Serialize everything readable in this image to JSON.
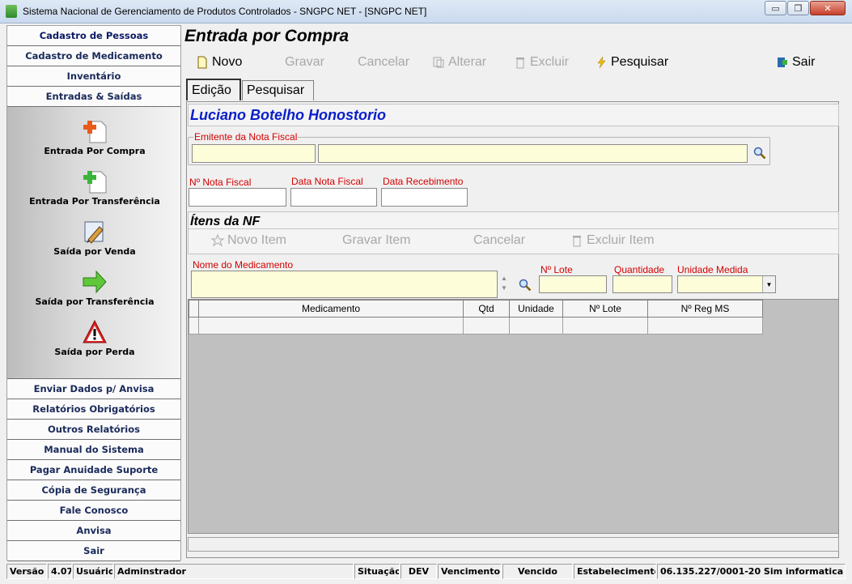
{
  "window": {
    "title": "Sistema Nacional de Gerenciamento de Produtos Controlados - SNGPC NET - [SNGPC NET]",
    "controls": {
      "minimize": "▭",
      "maximize": "❐",
      "close": "✕"
    }
  },
  "sidebar": {
    "top_items": [
      {
        "label": "Cadastro de Pessoas"
      },
      {
        "label": "Cadastro de Medicamento"
      },
      {
        "label": "Inventário"
      },
      {
        "label": "Entradas & Saídas"
      }
    ],
    "sub_items": [
      {
        "label": "Entrada Por Compra",
        "icon": "add-document-icon"
      },
      {
        "label": "Entrada Por Transferência",
        "icon": "add-green-document-icon"
      },
      {
        "label": "Saída por Venda",
        "icon": "pen-edit-icon"
      },
      {
        "label": "Saída por Transferência",
        "icon": "green-arrow-icon"
      },
      {
        "label": "Saída por Perda",
        "icon": "warning-icon"
      }
    ],
    "bottom_items": [
      {
        "label": "Enviar Dados p/ Anvisa"
      },
      {
        "label": "Relatórios Obrigatórios"
      },
      {
        "label": "Outros Relatórios"
      },
      {
        "label": "Manual do Sistema"
      },
      {
        "label": "Pagar Anuidade Suporte"
      },
      {
        "label": "Cópia de Segurança"
      },
      {
        "label": "Fale Conosco"
      },
      {
        "label": "Anvisa"
      },
      {
        "label": "Sair"
      }
    ]
  },
  "form": {
    "title": "Entrada por Compra",
    "toolbar": {
      "novo": "Novo",
      "gravar": "Gravar",
      "cancelar": "Cancelar",
      "alterar": "Alterar",
      "excluir": "Excluir",
      "pesquisar": "Pesquisar",
      "sair": "Sair"
    },
    "tabs": [
      "Edição",
      "Pesquisar"
    ],
    "person_name": "Luciano Botelho Honostorio",
    "emitente_legend": "Emitente da Nota Fiscal",
    "labels": {
      "nota_fiscal": "Nº Nota Fiscal",
      "data_nota": "Data Nota Fiscal",
      "data_recebimento": "Data Recebimento"
    },
    "items_section": "Ítens da NF",
    "items_toolbar": {
      "novo_item": "Novo Item",
      "gravar_item": "Gravar Item",
      "cancelar": "Cancelar",
      "excluir_item": "Excluir Item"
    },
    "item_labels": {
      "nome_medicamento": "Nome do Medicamento",
      "lote": "Nº Lote",
      "quantidade": "Quantidade",
      "unidade_medida": "Unidade Medida"
    },
    "grid_columns": [
      "Medicamento",
      "Qtd",
      "Unidade",
      "Nº Lote",
      "Nº Reg MS"
    ]
  },
  "statusbar": {
    "versao_label": "Versão",
    "versao_value": "4.07",
    "usuario_label": "Usuário",
    "usuario_value": "Adminstrador",
    "situacao_label": "Situação",
    "situacao_value": "DEV",
    "vencimento_label": "Vencimento",
    "vencimento_value": "Vencido",
    "estabelecimento_label": "Estabelecimento",
    "estabelecimento_value": "06.135.227/0001-20 Sim informatica"
  }
}
